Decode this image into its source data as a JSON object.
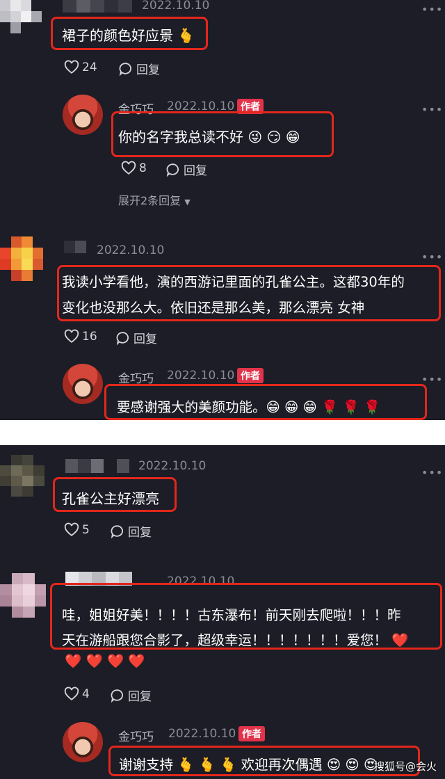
{
  "comments_top": [
    {
      "date": "2022.10.10",
      "text": "裙子的颜色好应景 🫰",
      "likes": "24",
      "reply_label": "回复"
    },
    {
      "author": "金巧巧",
      "badge": "作者",
      "date": "2022.10.10",
      "text": "你的名字我总读不好 😜 😏 😁",
      "likes": "8",
      "reply_label": "回复",
      "expand": "展开2条回复"
    },
    {
      "date": "2022.10.10",
      "text_line1": "我读小学看他，演的西游记里面的孔雀公主。这都30年的",
      "text_line2": "变化也没那么大。依旧还是那么美，那么漂亮 女神",
      "likes": "16",
      "reply_label": "回复"
    },
    {
      "author": "金巧巧",
      "badge": "作者",
      "date": "2022.10.10",
      "text": "要感谢强大的美颜功能。😁 😁 😁 🌹 🌹 🌹"
    }
  ],
  "comments_bottom": [
    {
      "date": "2022.10.10",
      "text": "孔雀公主好漂亮",
      "likes": "5",
      "reply_label": "回复"
    },
    {
      "date": "2022.10.10",
      "text_line1": "哇，姐姐好美！！！！古东瀑布！前天刚去爬啦！！！昨",
      "text_line2": "天在游船跟您合影了，超级幸运！！！！！！！爱您！ ❤️",
      "text_line3": "❤️ ❤️ ❤️ ❤️",
      "likes": "4",
      "reply_label": "回复"
    },
    {
      "author": "金巧巧",
      "badge": "作者",
      "date": "2022.10.10",
      "text": "谢谢支持 🫰 🫰 🫰 欢迎再次偶遇 😍 😍 😍"
    }
  ],
  "watermark": "搜狐号@会火",
  "colors": {
    "background": "#1c1d26",
    "highlight": "#e3271c",
    "badge": "#e2334b"
  }
}
